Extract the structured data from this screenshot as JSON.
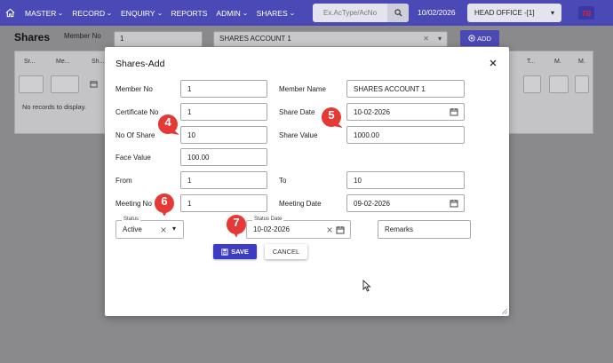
{
  "nav": {
    "menu": [
      {
        "label": "MASTER"
      },
      {
        "label": "RECORD"
      },
      {
        "label": "ENQUIRY"
      },
      {
        "label": "REPORTS"
      },
      {
        "label": "ADMIN"
      },
      {
        "label": "SHARES"
      }
    ],
    "search_placeholder": "Ex.AcType/AcNo",
    "date": "10/02/2026",
    "branch": "HEAD OFFICE -[1]"
  },
  "page": {
    "title": "Shares",
    "member_no_label": "Member No",
    "member_no_value": "1",
    "account_select": "SHARES ACCOUNT 1",
    "add_label": "ADD",
    "table_headers": [
      "Sr...",
      "Me...",
      "Sh...",
      "T...",
      "M.",
      "M."
    ],
    "no_records": "No records to display."
  },
  "modal": {
    "title": "Shares-Add",
    "fields": {
      "member_no": {
        "label": "Member No",
        "value": "1"
      },
      "member_name": {
        "label": "Member Name",
        "value": "SHARES ACCOUNT 1"
      },
      "certificate_no": {
        "label": "Certificate No",
        "value": "1"
      },
      "share_date": {
        "label": "Share Date",
        "value": "10-02-2026"
      },
      "no_of_share": {
        "label": "No Of Share",
        "value": "10"
      },
      "share_value": {
        "label": "Share Value",
        "value": "1000.00"
      },
      "face_value": {
        "label": "Face Value",
        "value": "100.00"
      },
      "from": {
        "label": "From",
        "value": "1"
      },
      "to": {
        "label": "To",
        "value": "10"
      },
      "meeting_no": {
        "label": "Meeting No",
        "value": "1"
      },
      "meeting_date": {
        "label": "Meeting Date",
        "value": "09-02-2026"
      },
      "status": {
        "label": "Status",
        "value": "Active"
      },
      "status_date": {
        "label": "Status Date",
        "value": "10-02-2026"
      },
      "remarks": {
        "placeholder": "Remarks"
      }
    },
    "save_label": "SAVE",
    "cancel_label": "CANCEL"
  },
  "markers": [
    "4",
    "5",
    "6",
    "7"
  ],
  "colors": {
    "nav": "#4a49b6",
    "primary": "#3d3bc4",
    "marker": "#e53935"
  },
  "icons": [
    "home-icon",
    "search-icon",
    "calendar-icon",
    "close-icon",
    "save-icon",
    "plus-circle-icon",
    "chevron-down-icon",
    "clear-icon"
  ]
}
